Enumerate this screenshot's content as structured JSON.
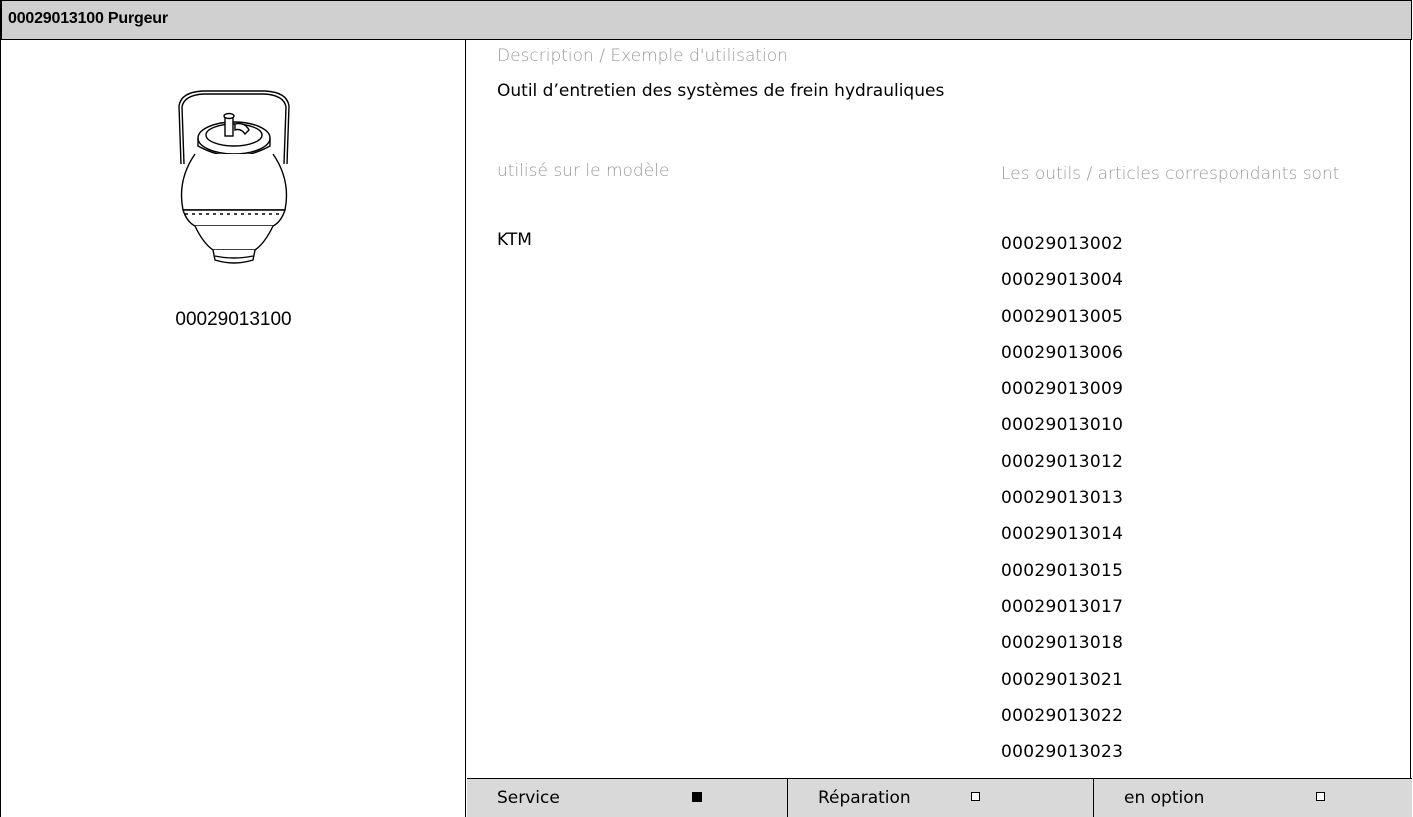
{
  "header": {
    "title": "00029013100 Purgeur"
  },
  "image": {
    "caption": "00029013100",
    "icon": "bleeder-tool-drawing"
  },
  "description": {
    "label": "Description / Exemple d'utilisation",
    "text": "Outil d’entretien des systèmes de frein hydrauliques"
  },
  "usage": {
    "model_label": "utilisé sur le modèle",
    "related_label": "Les outils / articles correspondants sont",
    "model_value": "KTM",
    "parts": [
      "00029013002",
      "00029013004",
      "00029013005",
      "00029013006",
      "00029013009",
      "00029013010",
      "00029013012",
      "00029013013",
      "00029013014",
      "00029013015",
      "00029013017",
      "00029013018",
      "00029013021",
      "00029013022",
      "00029013023"
    ]
  },
  "footer": {
    "service_label": "Service",
    "service_checked": true,
    "repair_label": "Réparation",
    "repair_checked": false,
    "optional_label": "en option",
    "optional_checked": false
  }
}
